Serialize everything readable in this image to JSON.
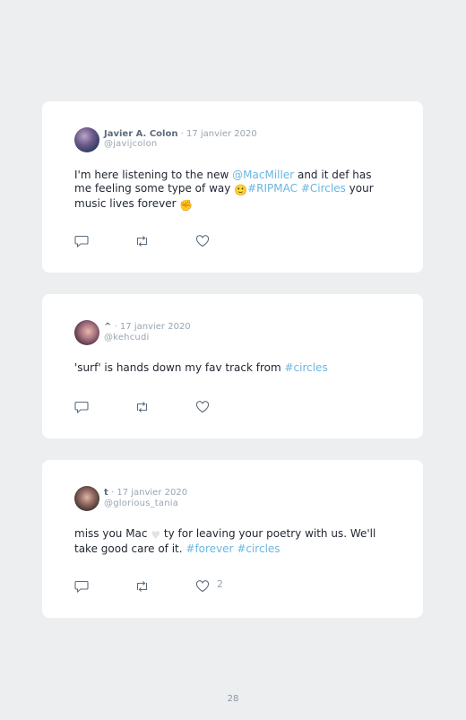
{
  "tweets": [
    {
      "name": "Javier A. Colon",
      "date": "· 17 janvier 2020",
      "handle": "@javijcolon",
      "text": [
        {
          "t": "I'm here listening to the new ",
          "link": false
        },
        {
          "t": "@MacMiller",
          "link": true
        },
        {
          "t": " and it def has me feeling some type of way ",
          "link": false
        },
        {
          "t": "🙂",
          "emoji": "sad-face-emoji"
        },
        {
          "t": "#RIPMAC",
          "link": true
        },
        {
          "t": " ",
          "link": false
        },
        {
          "t": "#Circles",
          "link": true
        },
        {
          "t": " your music lives forever ",
          "link": false
        },
        {
          "t": "✊",
          "emoji": "raised-fist-emoji"
        }
      ],
      "likes": ""
    },
    {
      "name": "^",
      "date": "· 17 janvier 2020",
      "handle": "@kehcudi",
      "text": [
        {
          "t": "'surf' is hands down my fav track from ",
          "link": false
        },
        {
          "t": "#circles",
          "link": true
        }
      ],
      "likes": ""
    },
    {
      "name": "t",
      "date": "· 17 janvier 2020",
      "handle": "@glorious_tania",
      "text": [
        {
          "t": "miss you Mac ",
          "link": false
        },
        {
          "t": "♥",
          "emoji": "white-heart-emoji"
        },
        {
          "t": " ty for leaving your poetry with us. We'll take good care of it. ",
          "link": false
        },
        {
          "t": "#forever",
          "link": true
        },
        {
          "t": " ",
          "link": false
        },
        {
          "t": "#circles",
          "link": true
        }
      ],
      "likes": "2"
    }
  ],
  "page_number": "28",
  "colors": {
    "background": "#eceef0",
    "card": "#ffffff",
    "link": "#6ab6e2",
    "name": "#5d6b7d",
    "muted": "#9aa5b1"
  }
}
